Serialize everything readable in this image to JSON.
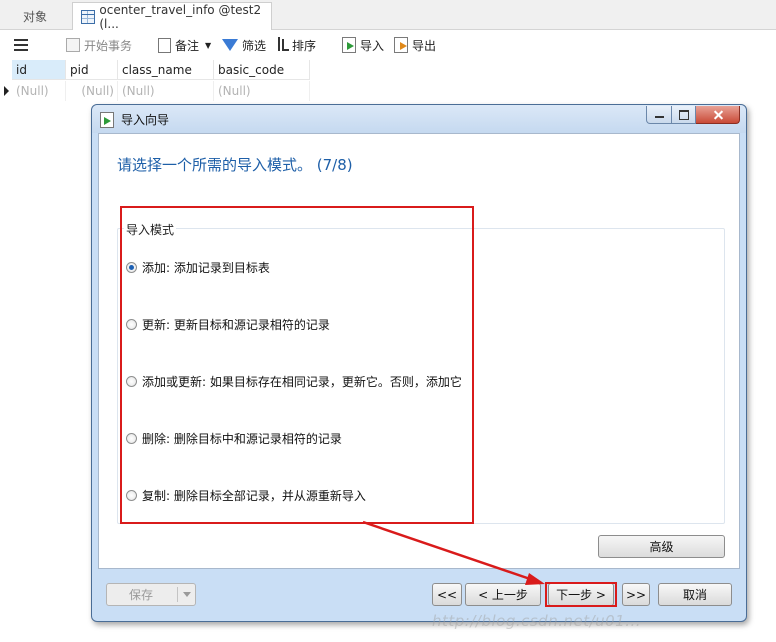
{
  "tabs": {
    "objects": "对象",
    "table": "ocenter_travel_info @test2 (l..."
  },
  "toolbar": {
    "begin_transaction": "开始事务",
    "memo": "备注",
    "filter": "筛选",
    "sort": "排序",
    "import": "导入",
    "export": "导出"
  },
  "grid": {
    "columns": [
      "id",
      "pid",
      "class_name",
      "basic_code"
    ],
    "row": [
      "(Null)",
      "(Null)",
      "(Null)",
      "(Null)"
    ]
  },
  "dialog": {
    "title": "导入向导",
    "heading": "请选择一个所需的导入模式。 (7/8)",
    "group_label": "导入模式",
    "modes": [
      {
        "label": "添加: 添加记录到目标表",
        "checked": true
      },
      {
        "label": "更新: 更新目标和源记录相符的记录",
        "checked": false
      },
      {
        "label": "添加或更新: 如果目标存在相同记录，更新它。否则，添加它",
        "checked": false
      },
      {
        "label": "删除: 删除目标中和源记录相符的记录",
        "checked": false
      },
      {
        "label": "复制: 删除目标全部记录，并从源重新导入",
        "checked": false
      }
    ],
    "advanced_label": "高级",
    "save_label": "保存",
    "first_label": "<<",
    "prev_label": "< 上一步",
    "next_label": "下一步 >",
    "last_label": ">>",
    "cancel_label": "取消"
  },
  "annotation_color": "#d91b1b",
  "watermark": "http://blog.csdn.net/u01..."
}
